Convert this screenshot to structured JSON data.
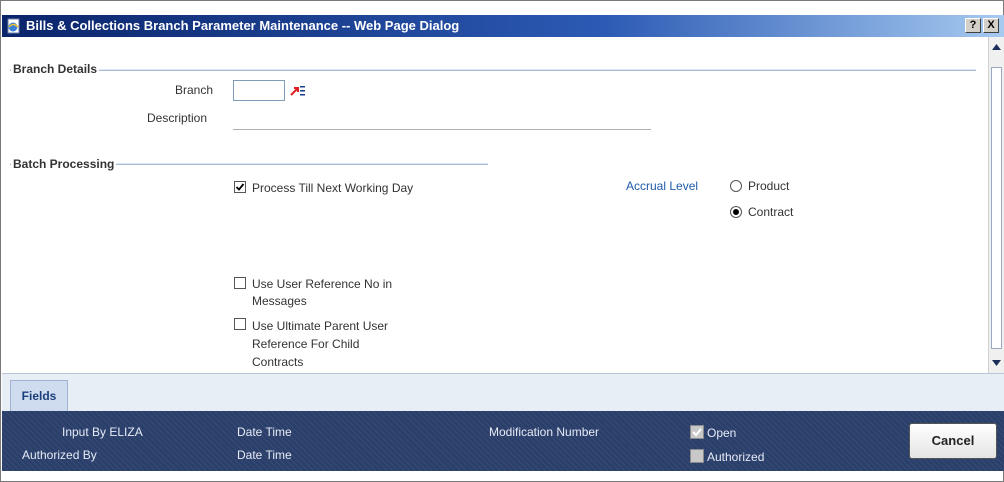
{
  "window": {
    "title": "Bills & Collections Branch Parameter Maintenance -- Web Page Dialog",
    "help_label": "?",
    "close_label": "X"
  },
  "branch_details": {
    "section_title": "Branch Details",
    "branch_label": "Branch",
    "branch_value": "",
    "description_label": "Description",
    "description_value": ""
  },
  "batch_processing": {
    "section_title": "Batch Processing",
    "process_till_next_working_day": {
      "label": "Process Till Next Working Day",
      "checked": true
    },
    "accrual_level": {
      "label": "Accrual Level",
      "options": [
        {
          "label": "Product",
          "selected": false
        },
        {
          "label": "Contract",
          "selected": true
        }
      ]
    },
    "use_user_reference": {
      "label_line1": "Use User Reference No in",
      "label_line2": "Messages",
      "checked": false
    },
    "use_ultimate_parent": {
      "label_line1": "Use Ultimate Parent User",
      "label_line2": "Reference For Child",
      "label_line3": "Contracts",
      "checked": false
    }
  },
  "tabs": [
    {
      "label": "Fields"
    }
  ],
  "footer": {
    "input_by": "Input By ELIZA",
    "authorized_by": "Authorized By",
    "date_time_1": "Date Time",
    "date_time_2": "Date Time",
    "modification_number": "Modification Number",
    "open_label": "Open",
    "open_checked": true,
    "authorized_label": "Authorized",
    "authorized_checked": false,
    "cancel_label": "Cancel"
  }
}
